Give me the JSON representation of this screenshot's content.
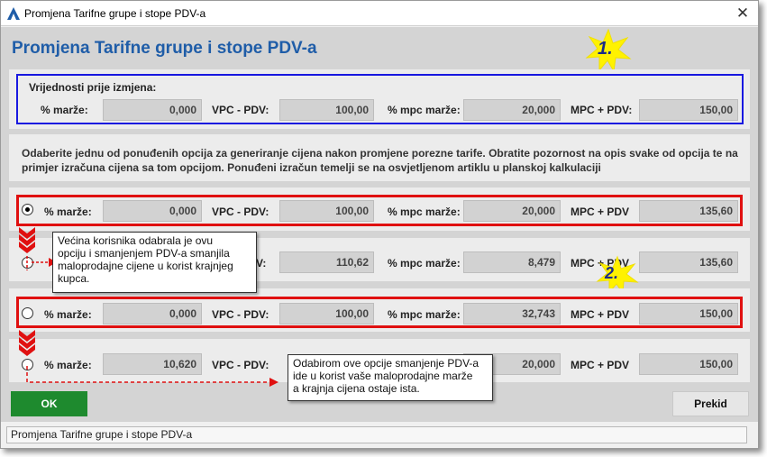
{
  "window": {
    "title": "Promjena Tarifne grupe i stope PDV-a",
    "close_glyph": "✕"
  },
  "dialog": {
    "heading": "Promjena Tarifne grupe i stope PDV-a"
  },
  "before": {
    "caption": "Vrijednosti prije izmjena:",
    "marza_label": "% marže:",
    "marza": "0,000",
    "vpc_label": "VPC - PDV:",
    "vpc": "100,00",
    "mpc_marza_label": "% mpc marže:",
    "mpc_marza": "20,000",
    "mpc_label": "MPC + PDV:",
    "mpc": "150,00"
  },
  "instructions": {
    "line1": "Odaberite jednu od ponuđenih opcija za generiranje cijena nakon promjene porezne tarife. Obratite pozornost na opis svake od opcija te na",
    "line2": "primjer izračuna cijena sa tom opcijom. Ponuđeni izračun temelji se na osvjetljenom artiklu u planskoj kalkulaciji"
  },
  "options": [
    {
      "selected": true,
      "marza_label": "% marže:",
      "marza": "0,000",
      "vpc_label": "VPC - PDV:",
      "vpc": "100,00",
      "mpc_marza_label": "% mpc marže:",
      "mpc_marza": "20,000",
      "mpc_label": "MPC + PDV",
      "mpc": "135,60"
    },
    {
      "selected": false,
      "vpc_label_tail": "V:",
      "vpc": "110,62",
      "mpc_marza_label": "% mpc marže:",
      "mpc_marza": "8,479",
      "mpc_label": "MPC + PDV",
      "mpc": "135,60"
    },
    {
      "selected": false,
      "marza_label": "% marže:",
      "marza": "0,000",
      "vpc_label": "VPC - PDV:",
      "vpc": "100,00",
      "mpc_marza_label": "% mpc marže:",
      "mpc_marza": "32,743",
      "mpc_label": "MPC + PDV",
      "mpc": "150,00"
    },
    {
      "selected": false,
      "marza_label": "% marže:",
      "marza": "10,620",
      "vpc_label": "VPC - PDV:",
      "mpc_marza": "20,000",
      "mpc_label": "MPC + PDV",
      "mpc": "150,00"
    }
  ],
  "callouts": {
    "first": [
      "Većina korisnika odabrala  je ovu",
      "opciju i smanjenjem PDV-a smanjila",
      "maloprodajne cijene u korist krajnjeg",
      "kupca."
    ],
    "second": [
      "Odabirom ove opcije smanjenje PDV-a",
      "ide u korist vaše maloprodajne marže",
      "a krajnja cijena ostaje ista."
    ]
  },
  "markers": {
    "one": "1.",
    "two": "2."
  },
  "buttons": {
    "ok": "OK",
    "cancel": "Prekid"
  },
  "status": {
    "text": "Promjena Tarifne grupe i stope PDV-a"
  },
  "colors": {
    "heading": "#1f5da8",
    "ok_button": "#1e8a2e",
    "highlight_red": "#e01010",
    "highlight_blue": "#1818e0",
    "marker_star": "#fff200"
  }
}
